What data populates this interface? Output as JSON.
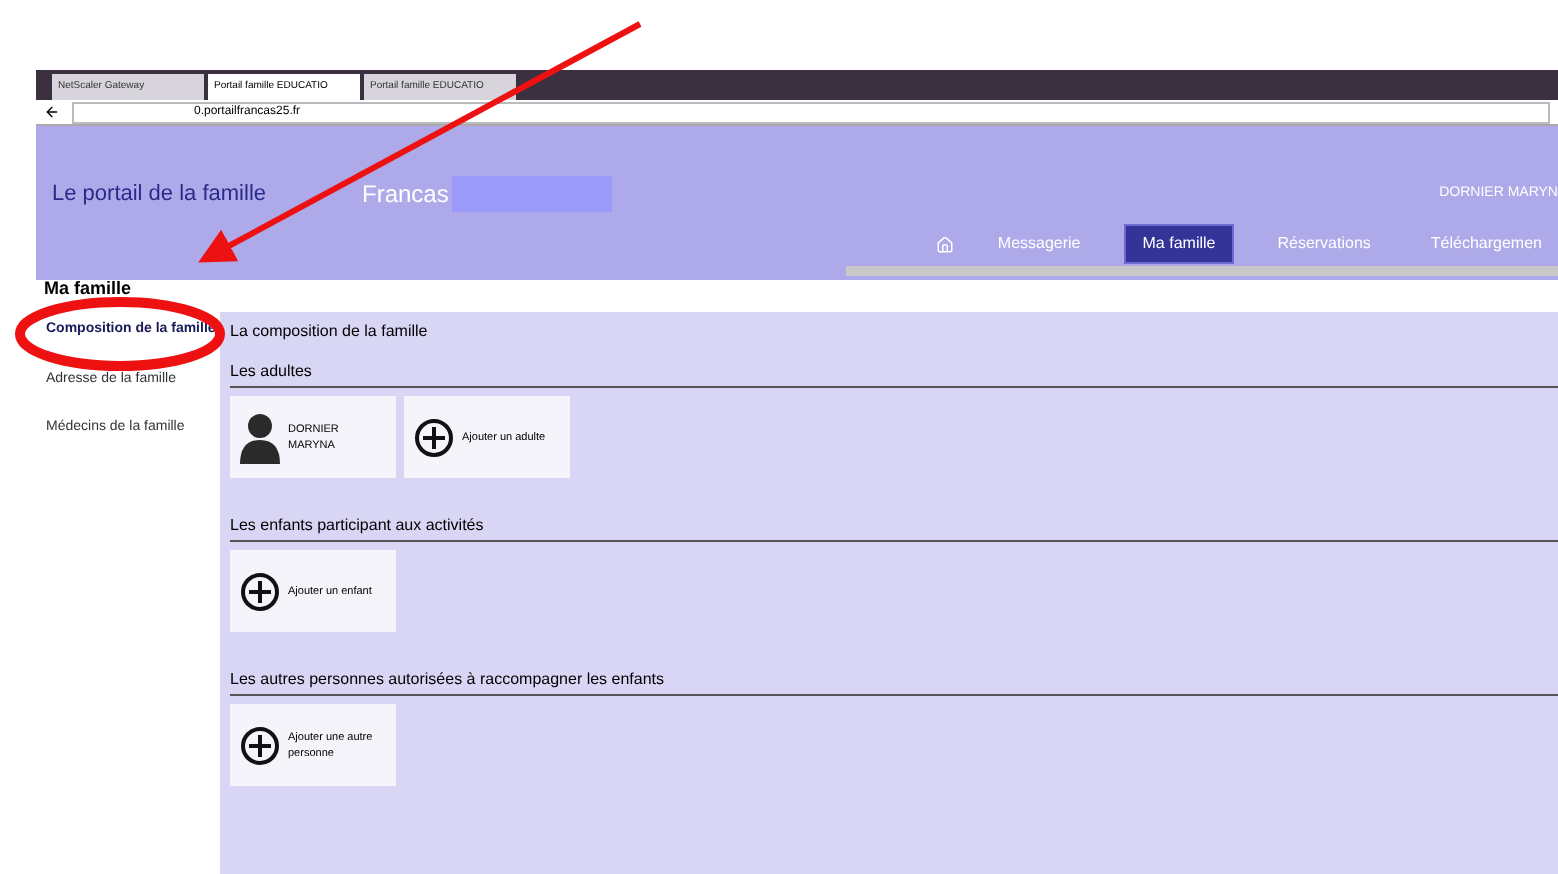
{
  "browser": {
    "tabs": [
      {
        "label": "NetScaler Gateway",
        "selected": false
      },
      {
        "label": "Portail famille EDUCATIO",
        "selected": true
      },
      {
        "label": "Portail famille EDUCATIO",
        "selected": false
      }
    ],
    "address": "0.portailfrancas25.fr"
  },
  "header": {
    "title": "Le portail de la famille",
    "subtitle": "Francas",
    "user": "DORNIER MARYN",
    "nav": [
      {
        "label": "Messagerie",
        "selected": false
      },
      {
        "label": "Ma famille",
        "selected": true
      },
      {
        "label": "Réservations",
        "selected": false
      },
      {
        "label": "Téléchargemen",
        "selected": false
      }
    ]
  },
  "sidebar": {
    "title": "Ma famille",
    "items": [
      {
        "label": "Composition de la famille",
        "selected": true
      },
      {
        "label": "Adresse de la famille",
        "selected": false
      },
      {
        "label": "Médecins de la famille",
        "selected": false
      }
    ]
  },
  "content": {
    "title": "La composition de la famille",
    "sections": [
      {
        "title": "Les adultes",
        "cards": [
          {
            "kind": "person",
            "label": "DORNIER MARYNA"
          },
          {
            "kind": "add",
            "label": "Ajouter un adulte"
          }
        ]
      },
      {
        "title": "Les enfants participant aux activités",
        "cards": [
          {
            "kind": "add",
            "label": "Ajouter un enfant"
          }
        ]
      },
      {
        "title": "Les autres personnes autorisées à raccompagner les enfants",
        "cards": [
          {
            "kind": "add",
            "label": "Ajouter une autre personne"
          }
        ]
      }
    ]
  }
}
